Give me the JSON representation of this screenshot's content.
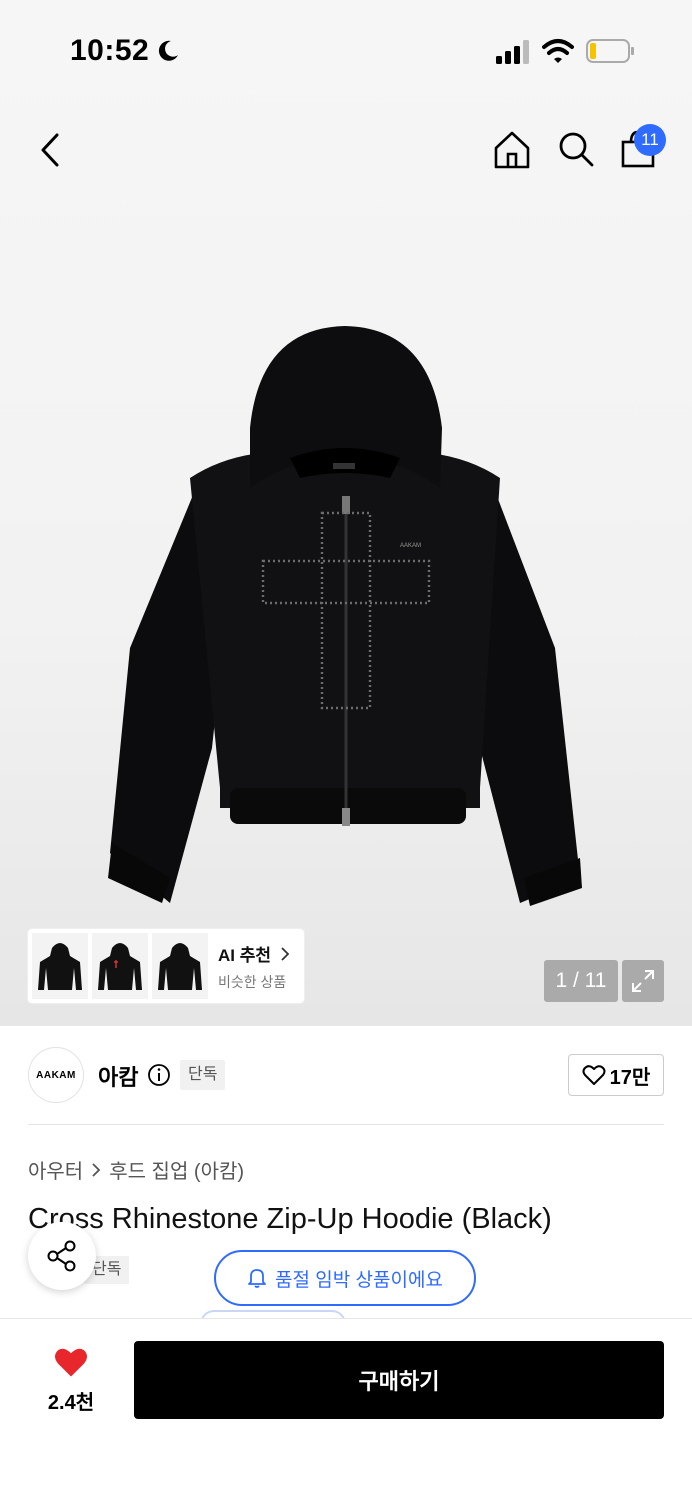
{
  "status_bar": {
    "time": "10:52",
    "icons": [
      "moon-icon",
      "signal-icon",
      "wifi-icon",
      "battery-icon"
    ]
  },
  "nav": {
    "icons": [
      "back-icon",
      "home-icon",
      "search-icon",
      "cart-icon"
    ],
    "cart_count": "11"
  },
  "product_image": {
    "brand_mark": "AAKAM",
    "zipper_label": "AAKAM"
  },
  "ai_recommend": {
    "title": "AI 추천",
    "subtitle": "비슷한 상품"
  },
  "gallery": {
    "counter": "1 / 11"
  },
  "brand": {
    "logo_text": "AAKAM",
    "name": "아캄",
    "tag": "단독",
    "likes": "17만"
  },
  "breadcrumb": {
    "category": "아우터",
    "subcategory": "후드 집업 (아캄)"
  },
  "product": {
    "title": "Cross Rhinestone Zip-Up Hoodie (Black)",
    "tag": "단독"
  },
  "soldout_notice": "품절 임박 상품이에요",
  "bottom": {
    "heart_count": "2.4천",
    "buy_label": "구매하기"
  },
  "colors": {
    "accent": "#2f6bff",
    "heart": "#e8272c",
    "buy_bg": "#000000"
  }
}
